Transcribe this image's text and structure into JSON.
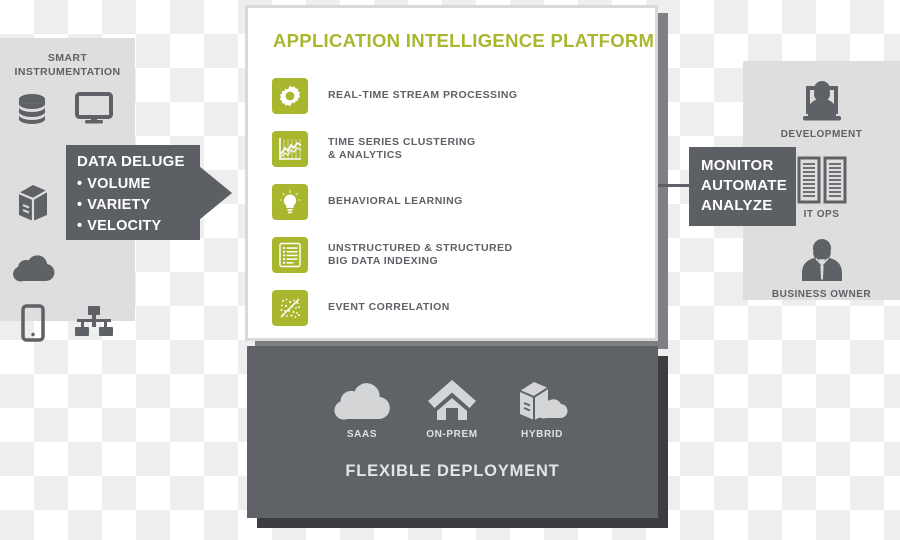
{
  "colors": {
    "accent_green": "#a9b72e",
    "dark_gray": "#5c5f63",
    "deploy_panel": "#5f6267",
    "light_panel": "#dedede",
    "text_gray": "#5e6166",
    "card_border": "#d9d9d9"
  },
  "left_column": {
    "title": "SMART\nINSTRUMENTATION",
    "icons": [
      {
        "name": "database-icon",
        "label": "database"
      },
      {
        "name": "monitor-icon",
        "label": "monitor"
      },
      {
        "name": "server-icon",
        "label": "server"
      },
      {
        "name": "cloud-icon",
        "label": "cloud"
      },
      {
        "name": "mobile-phone-icon",
        "label": "mobile phone"
      },
      {
        "name": "network-icon",
        "label": "network"
      }
    ]
  },
  "data_deluge": {
    "title": "DATA DELUGE",
    "items": [
      "VOLUME",
      "VARIETY",
      "VELOCITY"
    ],
    "arrow": "arrow-right-icon"
  },
  "platform": {
    "title": "APPLICATION INTELLIGENCE PLATFORM",
    "features": [
      {
        "icon": "gear-icon",
        "label": "REAL-TIME STREAM PROCESSING"
      },
      {
        "icon": "line-chart-icon",
        "label": "TIME SERIES CLUSTERING\n& ANALYTICS"
      },
      {
        "icon": "lightbulb-icon",
        "label": "BEHAVIORAL LEARNING"
      },
      {
        "icon": "document-list-icon",
        "label": "UNSTRUCTURED & STRUCTURED\nBIG DATA INDEXING"
      },
      {
        "icon": "scatter-plot-icon",
        "label": "EVENT CORRELATION"
      }
    ]
  },
  "deployment": {
    "title": "FLEXIBLE DEPLOYMENT",
    "options": [
      {
        "icon": "cloud-icon",
        "label": "SAAS"
      },
      {
        "icon": "house-icon",
        "label": "ON-PREM"
      },
      {
        "icon": "hybrid-cloud-icon",
        "label": "HYBRID"
      }
    ]
  },
  "monitor_callout": {
    "lines": [
      "MONITOR",
      "AUTOMATE",
      "ANALYZE"
    ]
  },
  "right_column": {
    "personas": [
      {
        "icon": "developer-icon",
        "label": "DEVELOPMENT"
      },
      {
        "icon": "server-rack-icon",
        "label": "IT OPS"
      },
      {
        "icon": "business-person-icon",
        "label": "BUSINESS OWNER"
      }
    ]
  }
}
